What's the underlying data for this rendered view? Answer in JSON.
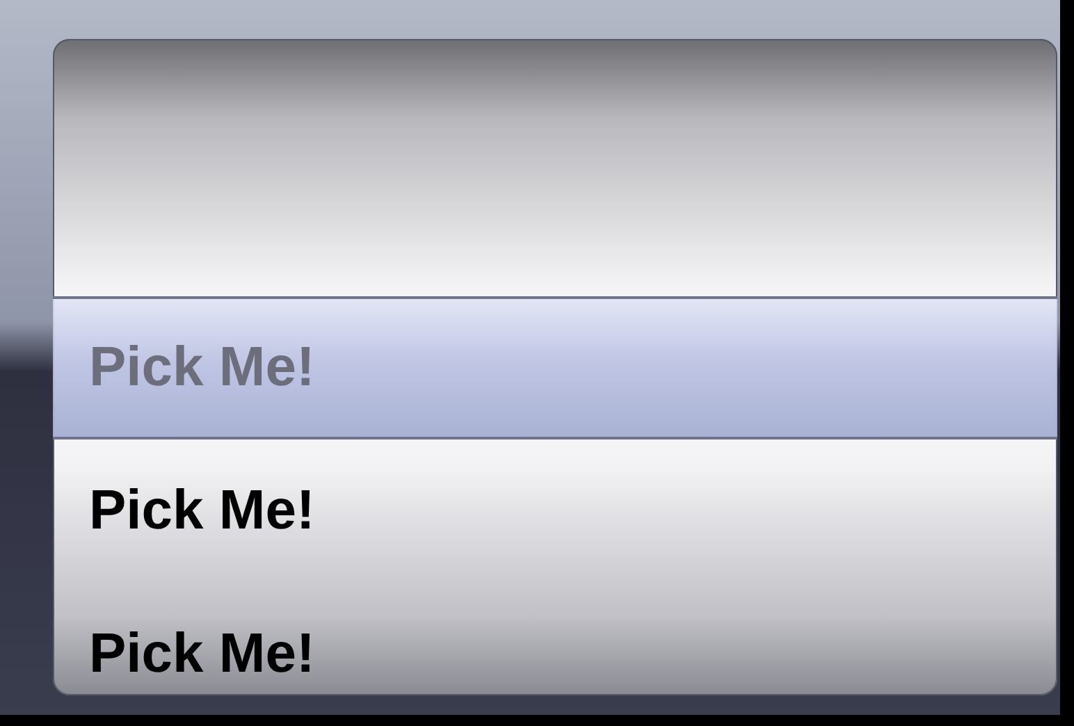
{
  "picker": {
    "rows": [
      {
        "label": "Pick Me!",
        "selected": true
      },
      {
        "label": "Pick Me!",
        "selected": false
      },
      {
        "label": "Pick Me!",
        "selected": false
      }
    ]
  }
}
